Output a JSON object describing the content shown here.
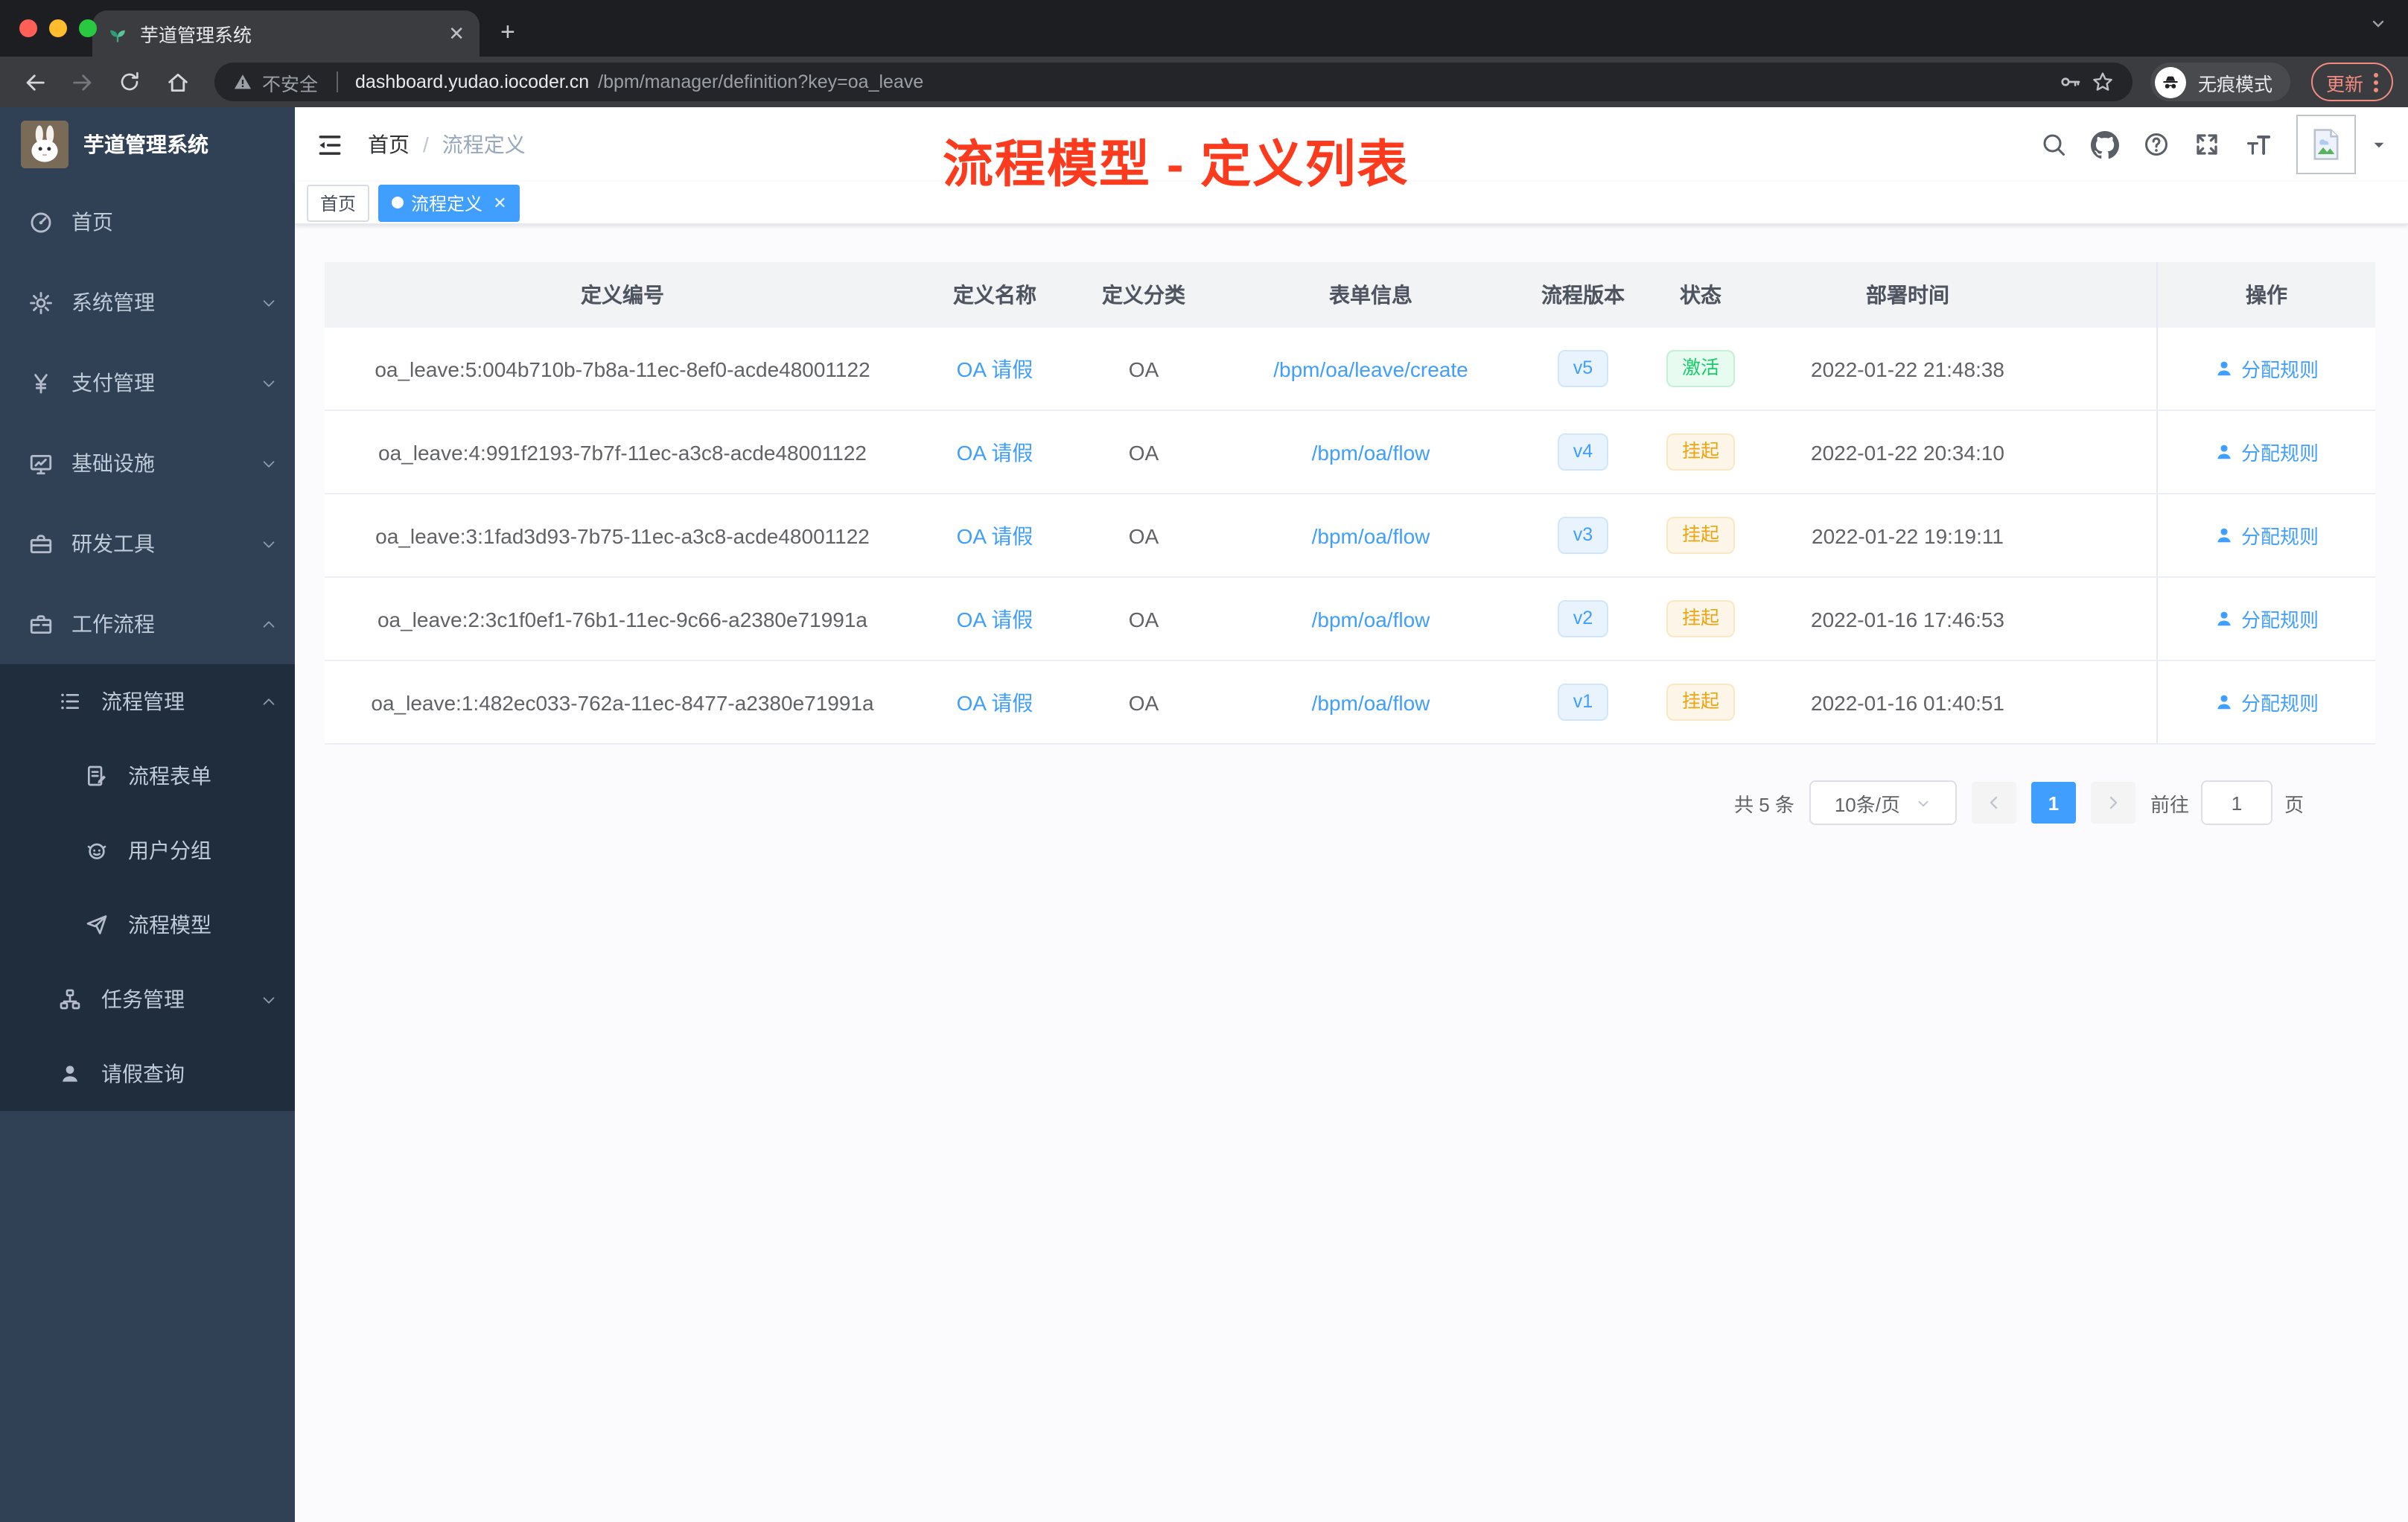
{
  "colors": {
    "accent": "#409eff",
    "success": "#13ce66",
    "warning": "#eda413",
    "annotation_red": "#fb3a1e",
    "sidebar_bg": "#304156",
    "submenu_bg": "#1f2d3d"
  },
  "browser": {
    "tab_title": "芋道管理系统",
    "security_label": "不安全",
    "url_host": "dashboard.yudao.iocoder.cn",
    "url_path": "/bpm/manager/definition?key=oa_leave",
    "incognito_label": "无痕模式",
    "update_label": "更新"
  },
  "sidebar": {
    "logo_title": "芋道管理系统",
    "items": [
      {
        "label": "首页",
        "icon": "dashboard-icon",
        "level": 1,
        "chevron": null
      },
      {
        "label": "系统管理",
        "icon": "gear-icon",
        "level": 1,
        "chevron": "down"
      },
      {
        "label": "支付管理",
        "icon": "yen-icon",
        "level": 1,
        "chevron": "down"
      },
      {
        "label": "基础设施",
        "icon": "monitor-icon",
        "level": 1,
        "chevron": "down"
      },
      {
        "label": "研发工具",
        "icon": "toolbox-icon",
        "level": 1,
        "chevron": "down"
      },
      {
        "label": "工作流程",
        "icon": "briefcase-icon",
        "level": 1,
        "chevron": "up"
      },
      {
        "label": "流程管理",
        "icon": "list-icon",
        "level": 2,
        "chevron": "up"
      },
      {
        "label": "流程表单",
        "icon": "form-icon",
        "level": 3,
        "chevron": null
      },
      {
        "label": "用户分组",
        "icon": "user-group-icon",
        "level": 3,
        "chevron": null
      },
      {
        "label": "流程模型",
        "icon": "paper-plane-icon",
        "level": 3,
        "chevron": null
      },
      {
        "label": "任务管理",
        "icon": "tree-icon",
        "level": 2,
        "chevron": "down"
      },
      {
        "label": "请假查询",
        "icon": "user-icon",
        "level": 2,
        "chevron": null
      }
    ]
  },
  "header": {
    "breadcrumb_home": "首页",
    "breadcrumb_separator": "/",
    "breadcrumb_current": "流程定义",
    "annotation": "流程模型 - 定义列表"
  },
  "tags": [
    {
      "label": "首页",
      "active": false,
      "closable": false
    },
    {
      "label": "流程定义",
      "active": true,
      "closable": true
    }
  ],
  "table": {
    "columns": [
      "定义编号",
      "定义名称",
      "定义分类",
      "表单信息",
      "流程版本",
      "状态",
      "部署时间",
      "操作"
    ],
    "rows": [
      {
        "id": "oa_leave:5:004b710b-7b8a-11ec-8ef0-acde48001122",
        "name": "OA 请假",
        "category": "OA",
        "form": "/bpm/oa/leave/create",
        "version": "v5",
        "status": "激活",
        "status_type": "success",
        "deploy_time": "2022-01-22 21:48:38",
        "action": "分配规则"
      },
      {
        "id": "oa_leave:4:991f2193-7b7f-11ec-a3c8-acde48001122",
        "name": "OA 请假",
        "category": "OA",
        "form": "/bpm/oa/flow",
        "version": "v4",
        "status": "挂起",
        "status_type": "warning",
        "deploy_time": "2022-01-22 20:34:10",
        "action": "分配规则"
      },
      {
        "id": "oa_leave:3:1fad3d93-7b75-11ec-a3c8-acde48001122",
        "name": "OA 请假",
        "category": "OA",
        "form": "/bpm/oa/flow",
        "version": "v3",
        "status": "挂起",
        "status_type": "warning",
        "deploy_time": "2022-01-22 19:19:11",
        "action": "分配规则"
      },
      {
        "id": "oa_leave:2:3c1f0ef1-76b1-11ec-9c66-a2380e71991a",
        "name": "OA 请假",
        "category": "OA",
        "form": "/bpm/oa/flow",
        "version": "v2",
        "status": "挂起",
        "status_type": "warning",
        "deploy_time": "2022-01-16 17:46:53",
        "action": "分配规则"
      },
      {
        "id": "oa_leave:1:482ec033-762a-11ec-8477-a2380e71991a",
        "name": "OA 请假",
        "category": "OA",
        "form": "/bpm/oa/flow",
        "version": "v1",
        "status": "挂起",
        "status_type": "warning",
        "deploy_time": "2022-01-16 01:40:51",
        "action": "分配规则"
      }
    ]
  },
  "pagination": {
    "total": "共 5 条",
    "page_size": "10条/页",
    "current_page": "1",
    "goto_label": "前往",
    "goto_value": "1",
    "goto_unit": "页"
  }
}
